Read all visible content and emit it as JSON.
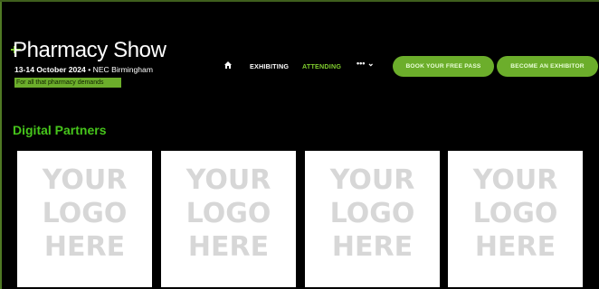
{
  "header": {
    "logo": {
      "title": "Pharmacy Show",
      "date": "13-14 October 2024",
      "venue": "• NEC Birmingham",
      "tagline": "For all that pharmacy demands"
    },
    "nav": {
      "home_icon": "home-icon",
      "items": [
        {
          "label": "EXHIBITING"
        },
        {
          "label": "ATTENDING"
        }
      ],
      "more_label": "•••",
      "more_icon": "chevron-down-icon"
    },
    "buttons": {
      "pass_label": "BOOK YOUR FREE PASS",
      "exhibitor_label": "BECOME AN EXHIBITOR"
    }
  },
  "colors": {
    "accent_green": "#6cae2b",
    "section_title_green": "#46c51b",
    "background": "#000000",
    "placeholder_text": "#d7d7d7"
  },
  "partners": {
    "title": "Digital Partners",
    "cards": [
      {
        "line1": "YOUR",
        "line2": "LOGO",
        "line3": "HERE"
      },
      {
        "line1": "YOUR",
        "line2": "LOGO",
        "line3": "HERE"
      },
      {
        "line1": "YOUR",
        "line2": "LOGO",
        "line3": "HERE"
      },
      {
        "line1": "YOUR",
        "line2": "LOGO",
        "line3": "HERE"
      }
    ]
  }
}
